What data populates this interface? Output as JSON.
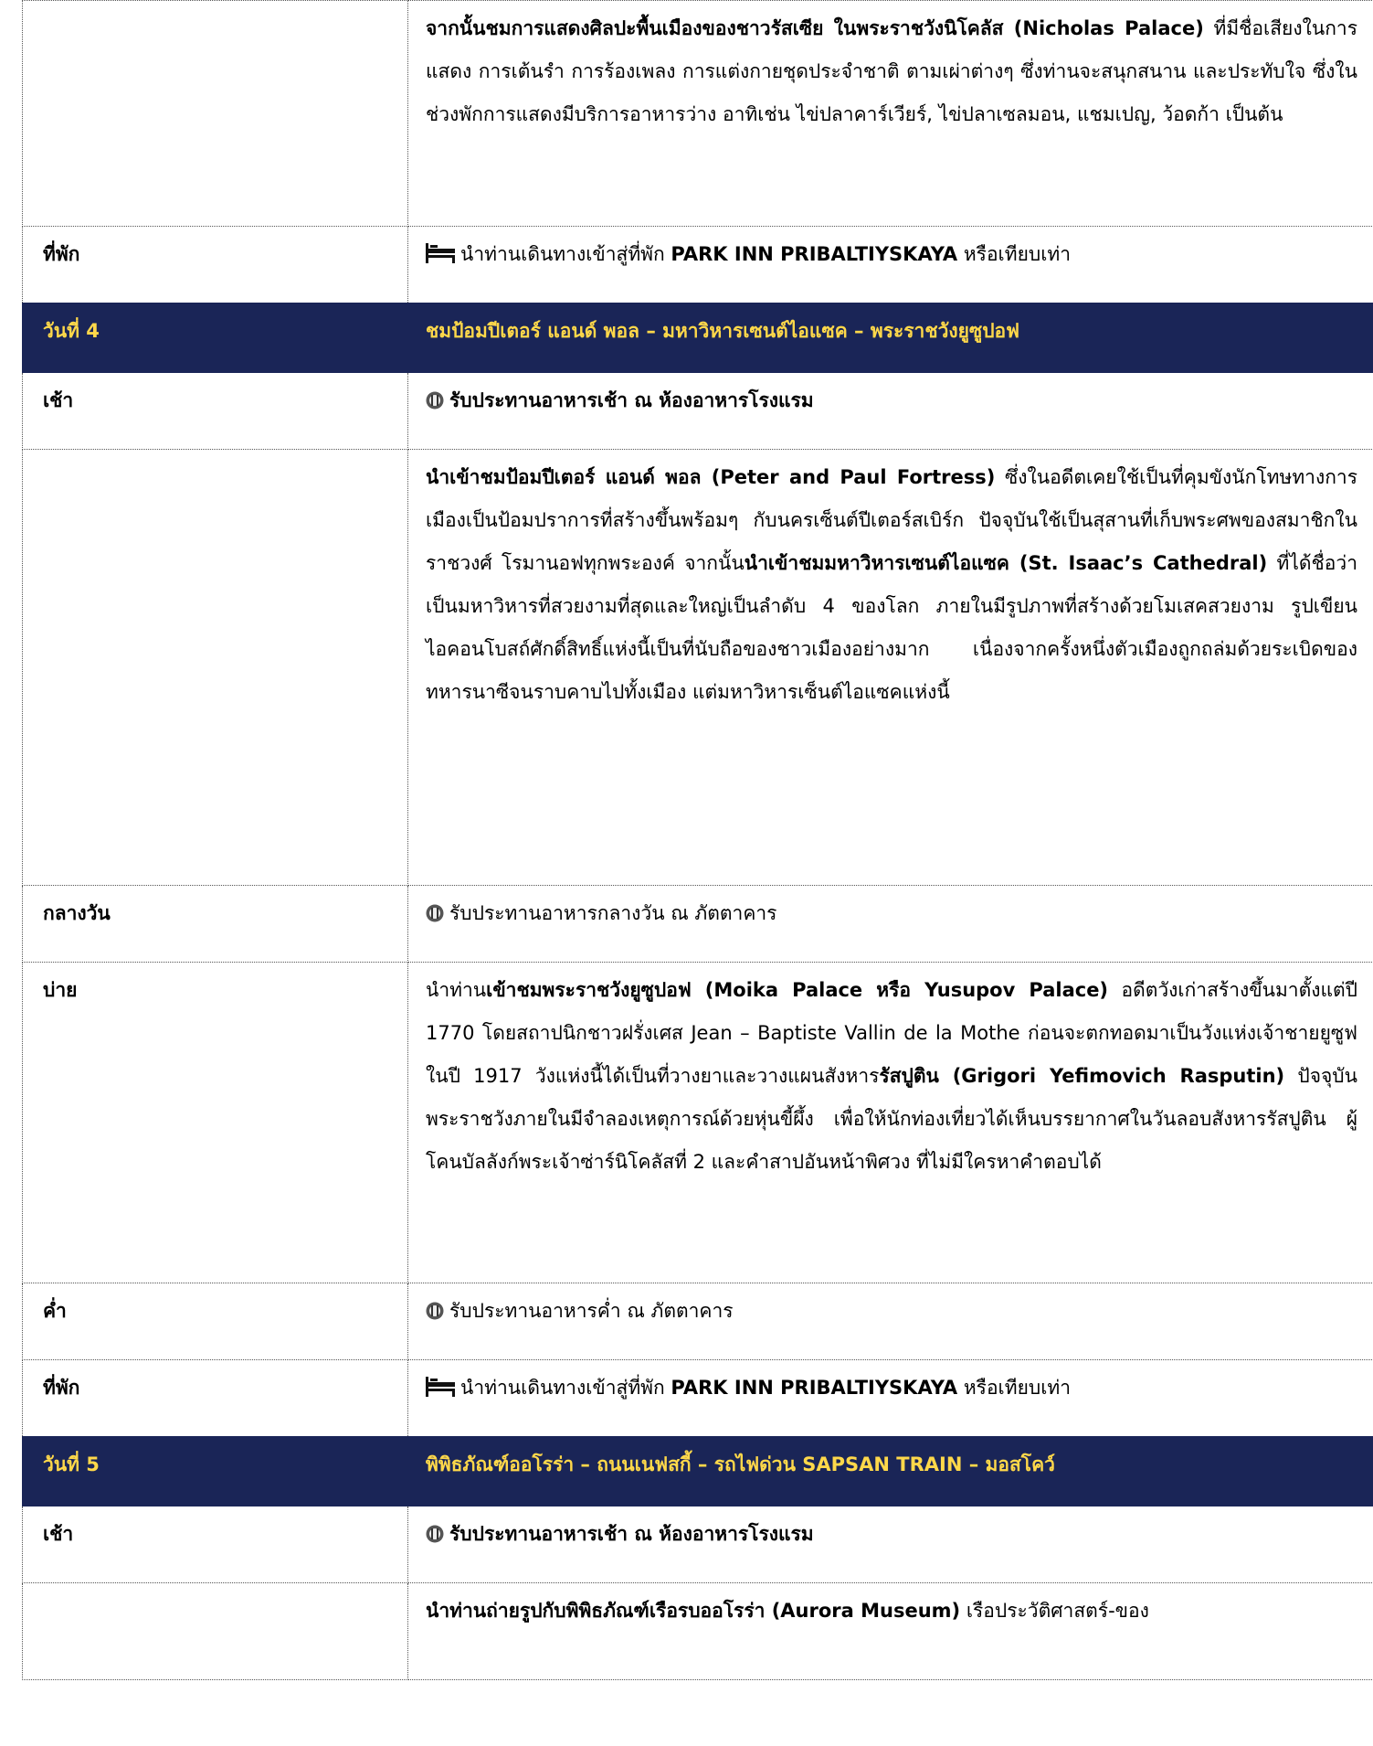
{
  "rows": {
    "r0": {
      "p1_b": "จากนั้นชมการแสดงศิลปะพื้นเมืองของชาวรัสเซีย ในพระราชวังนิโคลัส (Nicholas Palace)",
      "p1_t": " ที่มีชื่อเสียงในการแสดง การเต้นรำ การร้องเพลง การแต่งกายชุดประจำชาติ ตามเผ่าต่างๆ ซึ่งท่านจะสนุกสนาน และประทับใจ ซึ่งในช่วงพักการแสดงมีบริการอาหารว่าง อาทิเช่น ไข่ปลาคาร์เวียร์, ไข่ปลาเซลมอน, แชมเปญ, ว้อดก้า เป็นต้น"
    },
    "r1": {
      "label": "ที่พัก",
      "pre": "นำท่านเดินทางเข้าสู่ที่พัก ",
      "hotel": "PARK INN PRIBALTIYSKAYA",
      "post": " หรือเทียบเท่า"
    },
    "r2": {
      "label": "วันที่ 4",
      "title": "ชมป้อมปีเตอร์ แอนด์ พอล – มหาวิหารเซนต์ไอแซค – พระราชวังยูซูปอฟ"
    },
    "r3": {
      "label": "เช้า",
      "text": "รับประทานอาหารเช้า ณ ห้องอาหารโรงแรม"
    },
    "r4": {
      "b1": "นำเข้าชมป้อมปีเตอร์ แอนด์ พอล (Peter and Paul Fortress)",
      "t1": " ซึ่งในอดีตเคยใช้เป็นที่คุมขังนักโทษทางการเมืองเป็นป้อมปราการที่สร้างขึ้นพร้อมๆ กับนครเซ็นต์ปีเตอร์สเบิร์ก ปัจจุบันใช้เป็นสุสานที่เก็บพระศพของสมาชิกในราชวงศ์ โรมานอฟทุกพระองค์  จากนั้น",
      "b2": "นำเข้าชมมหาวิหารเซนต์ไอแซค (St. Isaac’s Cathedral)",
      "t2": " ที่ได้ชื่อว่าเป็นมหาวิหารที่สวยงามที่สุดและใหญ่เป็นลำดับ 4 ของโลก ภายในมีรูปภาพที่สร้างด้วยโมเสคสวยงาม รูปเขียนไอคอนโบสถ์ศักดิ์สิทธิ์แห่งนี้เป็นที่นับถือของชาวเมืองอย่างมาก เนื่องจากครั้งหนึ่งตัวเมืองถูกถล่มด้วยระเบิดของทหารนาซีจนราบคาบไปทั้งเมือง แต่มหาวิหารเซ็นต์ไอแซคแห่งนี้"
    },
    "r5": {
      "label": "กลางวัน",
      "text": "รับประทานอาหารกลางวัน ณ ภัตตาคาร"
    },
    "r6": {
      "label": "บ่าย",
      "t0": "นำท่าน",
      "b1": "เข้าชมพระราชวังยูซูปอฟ (Moika Palace หรือ Yusupov Palace)",
      "t1": " อดีตวังเก่าสร้างขึ้นมาตั้งแต่ปี 1770 โดยสถาปนิกชาวฝรั่งเศส Jean – Baptiste Vallin de la Mothe ก่อนจะตกทอดมาเป็นวังแห่งเจ้าชายยูซูฟ ในปี 1917 วังแห่งนี้ได้เป็นที่วางยาและวางแผนสังหาร",
      "b2": "รัสปูติน (Grigori  Yefimovich  Rasputin)",
      "t2": " ปัจจุบันพระราชวังภายในมีจำลองเหตุการณ์ด้วยหุ่นขี้ผึ้ง เพื่อให้นักท่องเที่ยวได้เห็นบรรยากาศในวันลอบสังหารรัสปูติน ผู้โคนบัลลังก์พระเจ้าซ่าร์นิโคลัสที่ 2 และคำสาปอันหน้าพิศวง ที่ไม่มีใครหาคำตอบได้"
    },
    "r7": {
      "label": "ค่ำ",
      "text": "รับประทานอาหารค่ำ ณ ภัตตาคาร"
    },
    "r8": {
      "label": "ที่พัก",
      "pre": "นำท่านเดินทางเข้าสู่ที่พัก ",
      "hotel": "PARK INN PRIBALTIYSKAYA",
      "post": " หรือเทียบเท่า"
    },
    "r9": {
      "label": "วันที่ 5",
      "title": "พิพิธภัณฑ์ออโรร่า – ถนนเนฟสกี้ – รถไฟด่วน SAPSAN TRAIN  – มอสโคว์"
    },
    "r10": {
      "label": "เช้า",
      "text": "รับประทานอาหารเช้า ณ ห้องอาหารโรงแรม"
    },
    "r11": {
      "b1": "นำท่านถ่ายรูปกับพิพิธภัณฑ์เรือรบออโรร่า (Aurora Museum)",
      "t1": " เรือประวัติศาสตร์-ของ"
    }
  },
  "colors": {
    "day_bg": "#1a2557",
    "day_text": "#ffd84a",
    "border": "#555555"
  },
  "icons": {
    "hotel": "bed-icon",
    "meal": "meal-icon"
  }
}
